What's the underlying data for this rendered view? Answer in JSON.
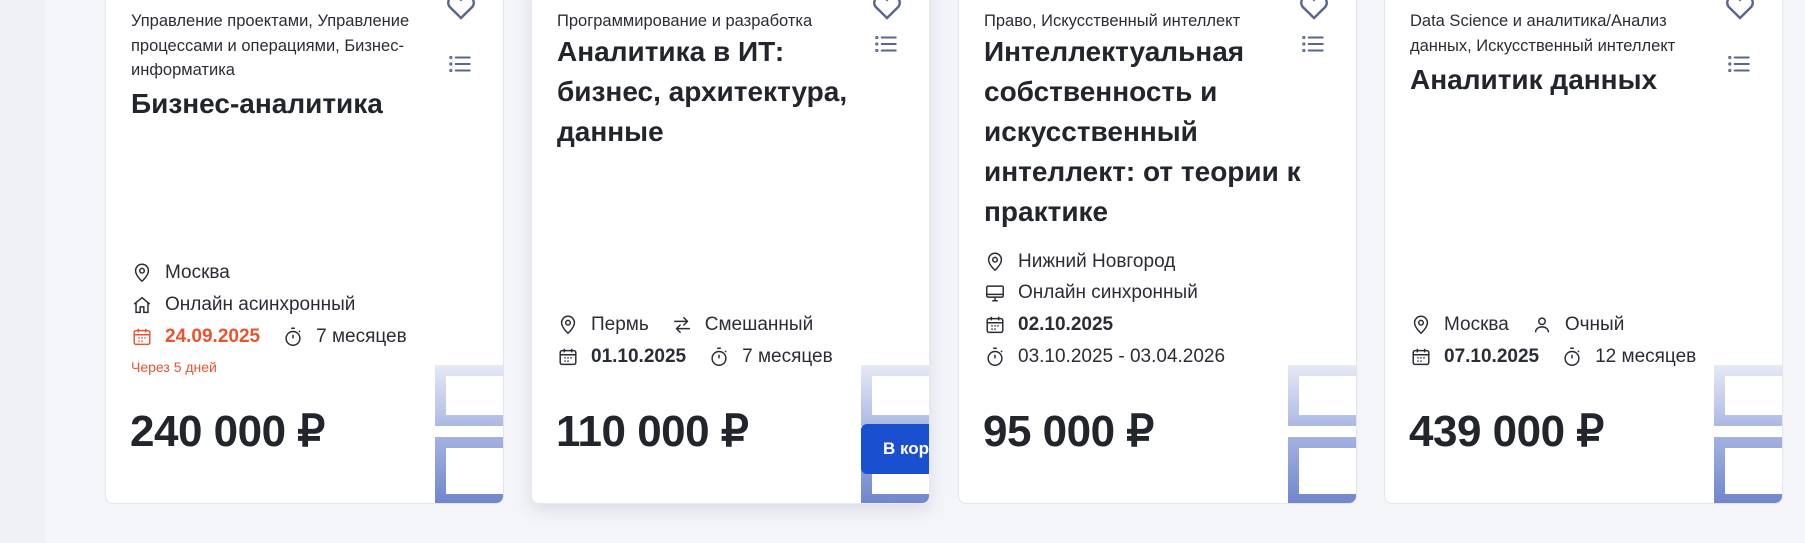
{
  "cards": [
    {
      "category": "Управление проектами, Управление процессами и операциями, Бизнес-информатика",
      "title": "Бизнес-аналитика",
      "location": "Москва",
      "format": "Онлайн асинхронный",
      "date": "24.09.2025",
      "duration": "7 месяцев",
      "note": "Через 5 дней",
      "price": "240 000 ₽"
    },
    {
      "category": "Программирование и разработка",
      "title": "Аналитика в ИТ: бизнес, архитектура, данные",
      "location": "Пермь",
      "format": "Смешанный",
      "date": "01.10.2025",
      "duration": "7 месяцев",
      "price": "110 000 ₽",
      "cart_button": "В корзину"
    },
    {
      "category": "Право, Искусственный интеллект",
      "title": "Интеллектуальная собственность и искусственный интеллект: от теории к практике",
      "location": "Нижний Новгород",
      "format": "Онлайн синхронный",
      "date": "02.10.2025",
      "dates_range": "03.10.2025 - 03.04.2026",
      "price": "95 000 ₽"
    },
    {
      "category": "Data Science и аналитика/Анализ данных, Искусственный интеллект",
      "title": "Аналитик данных",
      "location": "Москва",
      "format": "Очный",
      "date": "07.10.2025",
      "duration": "12 месяцев",
      "price": "439 000 ₽"
    }
  ],
  "icons": {
    "favorite": "heart-icon",
    "program": "list-icon",
    "location": "location-pin-icon",
    "online-async": "home-icon",
    "mixed": "swap-arrows-icon",
    "online-sync": "monitor-icon",
    "offline": "person-icon",
    "date": "calendar-icon",
    "duration": "stopwatch-icon"
  },
  "colors": {
    "accent_blue": "#1a4fd0",
    "deadline_orange": "#e8542f",
    "icon_slate": "#5a6690",
    "deco_blue": "#6f85cc"
  }
}
